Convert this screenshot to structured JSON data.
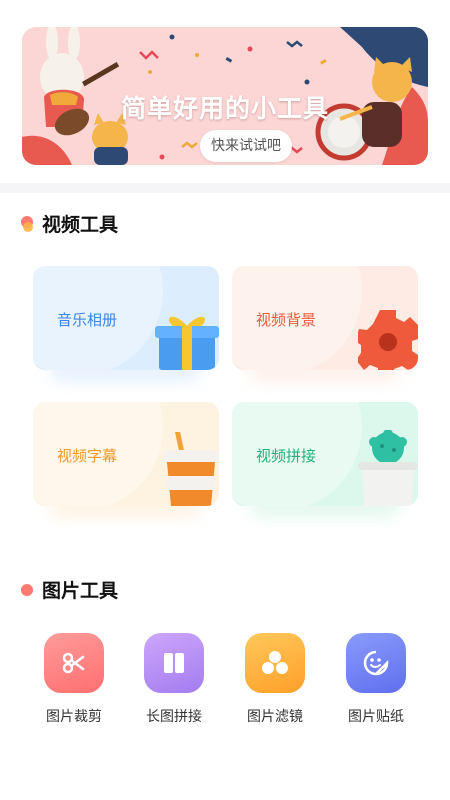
{
  "banner": {
    "title": "简单好用的小工具",
    "button_label": "快来试试吧"
  },
  "video_section": {
    "title": "视频工具",
    "cards": [
      {
        "label": "音乐相册",
        "color": "#3a86e6",
        "bg": "#dcedfd",
        "art": "gift-box-icon"
      },
      {
        "label": "视频背景",
        "color": "#ef5b3a",
        "bg": "#fdebe4",
        "art": "gear-icon"
      },
      {
        "label": "视频字幕",
        "color": "#f09a2b",
        "bg": "#fdf3e0",
        "art": "coffee-cup-icon"
      },
      {
        "label": "视频拼接",
        "color": "#22b37a",
        "bg": "#dcf7ec",
        "art": "cactus-pot-icon"
      }
    ]
  },
  "picture_section": {
    "title": "图片工具",
    "tools": [
      {
        "label": "图片裁剪",
        "color": "#ff7f7f",
        "icon": "scissors-icon"
      },
      {
        "label": "长图拼接",
        "color": "#b98cf5",
        "icon": "columns-icon"
      },
      {
        "label": "图片滤镜",
        "color": "#ffb43a",
        "icon": "circles-icon"
      },
      {
        "label": "图片贴纸",
        "color": "#6f82f3",
        "icon": "sticker-face-icon"
      }
    ]
  }
}
